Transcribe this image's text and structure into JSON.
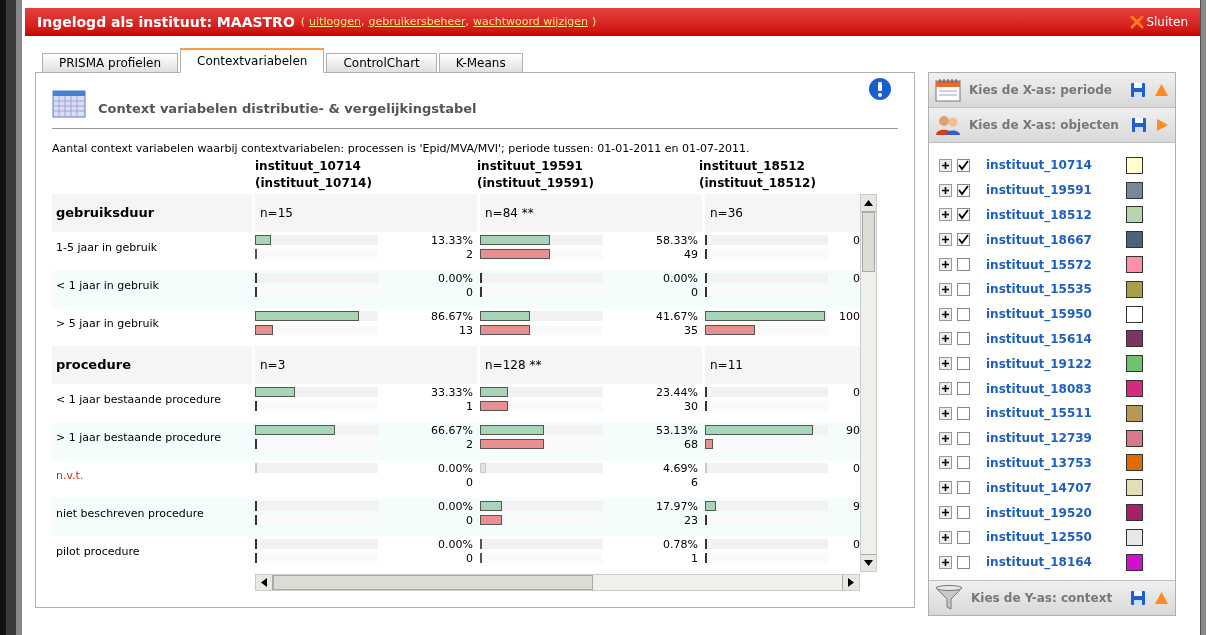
{
  "header": {
    "title": "Ingelogd als instituut: MAASTRO",
    "open_paren": "(",
    "links": [
      {
        "text": "uitloggen",
        "suffix": ","
      },
      {
        "text": "gebruikersbeheer",
        "suffix": ","
      },
      {
        "text": "wachtwoord wijzigen"
      }
    ],
    "close_paren": ")",
    "close": "Sluiten"
  },
  "tabs": [
    {
      "label": "PRISMA profielen",
      "selected": false
    },
    {
      "label": "Contextvariabelen",
      "selected": true
    },
    {
      "label": "ControlChart",
      "selected": false
    },
    {
      "label": "K-Means",
      "selected": false
    }
  ],
  "panel": {
    "title": "Context variabelen distributie- & vergelijkingstabel",
    "description": "Aantal context variabelen waarbij contextvariabelen: processen is 'Epid/MVA/MVI'; periode tussen: 01-01-2011 en 01-07-2011.",
    "columns": [
      {
        "name": "instituut_10714",
        "subtitle": "(instituut_10714)"
      },
      {
        "name": "instituut_19591",
        "subtitle": "(instituut_19591)"
      },
      {
        "name": "instituut_18512",
        "subtitle": "(instituut_18512)"
      }
    ],
    "groups": [
      {
        "label": "gebruiksduur",
        "counts": [
          "n=15",
          "n=84 **",
          "n=36"
        ],
        "rows": [
          {
            "label": "1-5 jaar in gebruik",
            "kind": "normal",
            "cells": [
              {
                "percent": "13.33%",
                "count": "2",
                "bars": [
                  {
                    "level": 0.1333
                  },
                  {
                    "level": 0.02
                  }
                ]
              },
              {
                "percent": "58.33%",
                "count": "49",
                "bars": [
                  {
                    "level": 0.5833
                  },
                  {
                    "level": 0.58
                  }
                ]
              },
              {
                "percent": "0",
                "bars": [
                  {
                    "level": 0
                  },
                  {
                    "level": 0
                  }
                ]
              }
            ]
          },
          {
            "label": "< 1 jaar in gebruik",
            "kind": "normal",
            "cells": [
              {
                "percent": "0.00%",
                "count": "0",
                "bars": [
                  {
                    "level": 0
                  },
                  {
                    "level": 0
                  }
                ]
              },
              {
                "percent": "0.00%",
                "count": "0",
                "bars": [
                  {
                    "level": 0
                  },
                  {
                    "level": 0
                  }
                ]
              },
              {
                "percent": "0",
                "bars": [
                  {
                    "level": 0
                  },
                  {
                    "level": 0
                  }
                ]
              }
            ]
          },
          {
            "label": "> 5 jaar in gebruik",
            "kind": "normal",
            "cells": [
              {
                "percent": "86.67%",
                "count": "13",
                "bars": [
                  {
                    "level": 0.8667
                  },
                  {
                    "level": 0.15
                  }
                ]
              },
              {
                "percent": "41.67%",
                "count": "35",
                "bars": [
                  {
                    "level": 0.4167
                  },
                  {
                    "level": 0.42
                  }
                ]
              },
              {
                "percent": "100",
                "bars": [
                  {
                    "level": 1
                  },
                  {
                    "level": 0.42
                  }
                ]
              }
            ]
          }
        ]
      },
      {
        "label": "procedure",
        "counts": [
          "n=3",
          "n=128 **",
          "n=11"
        ],
        "rows": [
          {
            "label": "< 1 jaar bestaande procedure",
            "kind": "normal",
            "cells": [
              {
                "percent": "33.33%",
                "count": "1",
                "bars": [
                  {
                    "level": 0.3333
                  },
                  {
                    "level": 0
                  }
                ]
              },
              {
                "percent": "23.44%",
                "count": "30",
                "bars": [
                  {
                    "level": 0.2344
                  },
                  {
                    "level": 0.23
                  }
                ]
              },
              {
                "percent": "0",
                "bars": [
                  {
                    "level": 0
                  },
                  {
                    "level": 0
                  }
                ]
              }
            ]
          },
          {
            "label": "> 1 jaar bestaande procedure",
            "kind": "normal",
            "cells": [
              {
                "percent": "66.67%",
                "count": "2",
                "bars": [
                  {
                    "level": 0.6667
                  },
                  {
                    "level": 0
                  }
                ]
              },
              {
                "percent": "53.13%",
                "count": "68",
                "bars": [
                  {
                    "level": 0.5313
                  },
                  {
                    "level": 0.53
                  }
                ]
              },
              {
                "percent": "90",
                "bars": [
                  {
                    "level": 0.9
                  },
                  {
                    "level": 0.07
                  }
                ]
              }
            ]
          },
          {
            "label": "n.v.t.",
            "kind": "not_applicable",
            "cells": [
              {
                "percent": "0.00%",
                "count": "0",
                "bars": [
                  {
                    "level": 0
                  }
                ]
              },
              {
                "percent": "4.69%",
                "count": "6",
                "bars": [
                  {
                    "level": 0.05
                  }
                ]
              },
              {
                "percent": "0",
                "bars": [
                  {
                    "level": 0
                  }
                ]
              }
            ]
          },
          {
            "label": "niet beschreven procedure",
            "kind": "normal",
            "cells": [
              {
                "percent": "0.00%",
                "count": "0",
                "bars": [
                  {
                    "level": 0
                  },
                  {
                    "level": 0
                  }
                ]
              },
              {
                "percent": "17.97%",
                "count": "23",
                "bars": [
                  {
                    "level": 0.1797
                  },
                  {
                    "level": 0.18
                  }
                ]
              },
              {
                "percent": "9",
                "bars": [
                  {
                    "level": 0.09
                  },
                  {
                    "level": 0
                  }
                ]
              }
            ]
          },
          {
            "label": "pilot procedure",
            "kind": "normal",
            "cells": [
              {
                "percent": "0.00%",
                "count": "0",
                "bars": [
                  {
                    "level": 0
                  },
                  {
                    "level": 0
                  }
                ]
              },
              {
                "percent": "0.78%",
                "count": "1",
                "bars": [
                  {
                    "level": 0.0078
                  },
                  {
                    "level": 0.0078
                  }
                ]
              },
              {
                "percent": "0",
                "bars": [
                  {
                    "level": 0
                  },
                  {
                    "level": 0
                  }
                ]
              }
            ]
          }
        ]
      }
    ]
  },
  "sidebar": {
    "sections": [
      {
        "title": "Kies de X-as: periode",
        "kind": "period",
        "expanded": false
      },
      {
        "title": "Kies de X-as: objecten",
        "kind": "objects",
        "expanded": true
      }
    ],
    "items": [
      {
        "label": "instituut_10714",
        "checked": true,
        "color": "#ffffcc"
      },
      {
        "label": "instituut_19591",
        "checked": true,
        "color": "#778899"
      },
      {
        "label": "instituut_18512",
        "checked": true,
        "color": "#b5d6ac"
      },
      {
        "label": "instituut_18667",
        "checked": true,
        "color": "#4a6480"
      },
      {
        "label": "instituut_15572",
        "checked": false,
        "color": "#ff8fa8"
      },
      {
        "label": "instituut_15535",
        "checked": false,
        "color": "#a8a048"
      },
      {
        "label": "instituut_15950",
        "checked": false,
        "color": "#ffffff"
      },
      {
        "label": "instituut_15614",
        "checked": false,
        "color": "#7a3560"
      },
      {
        "label": "instituut_19122",
        "checked": false,
        "color": "#70c070"
      },
      {
        "label": "instituut_18083",
        "checked": false,
        "color": "#d82880"
      },
      {
        "label": "instituut_15511",
        "checked": false,
        "color": "#b89858"
      },
      {
        "label": "instituut_12739",
        "checked": false,
        "color": "#d87888"
      },
      {
        "label": "instituut_13753",
        "checked": false,
        "color": "#e06c00"
      },
      {
        "label": "instituut_14707",
        "checked": false,
        "color": "#e0e0b8"
      },
      {
        "label": "instituut_19520",
        "checked": false,
        "color": "#a82068"
      },
      {
        "label": "instituut_12550",
        "checked": false,
        "color": "#e8e8e8"
      },
      {
        "label": "instituut_18164",
        "checked": false,
        "color": "#d010d0"
      }
    ],
    "footer": {
      "title": "Kies de Y-as: context",
      "kind": "filter",
      "expanded": false
    }
  }
}
